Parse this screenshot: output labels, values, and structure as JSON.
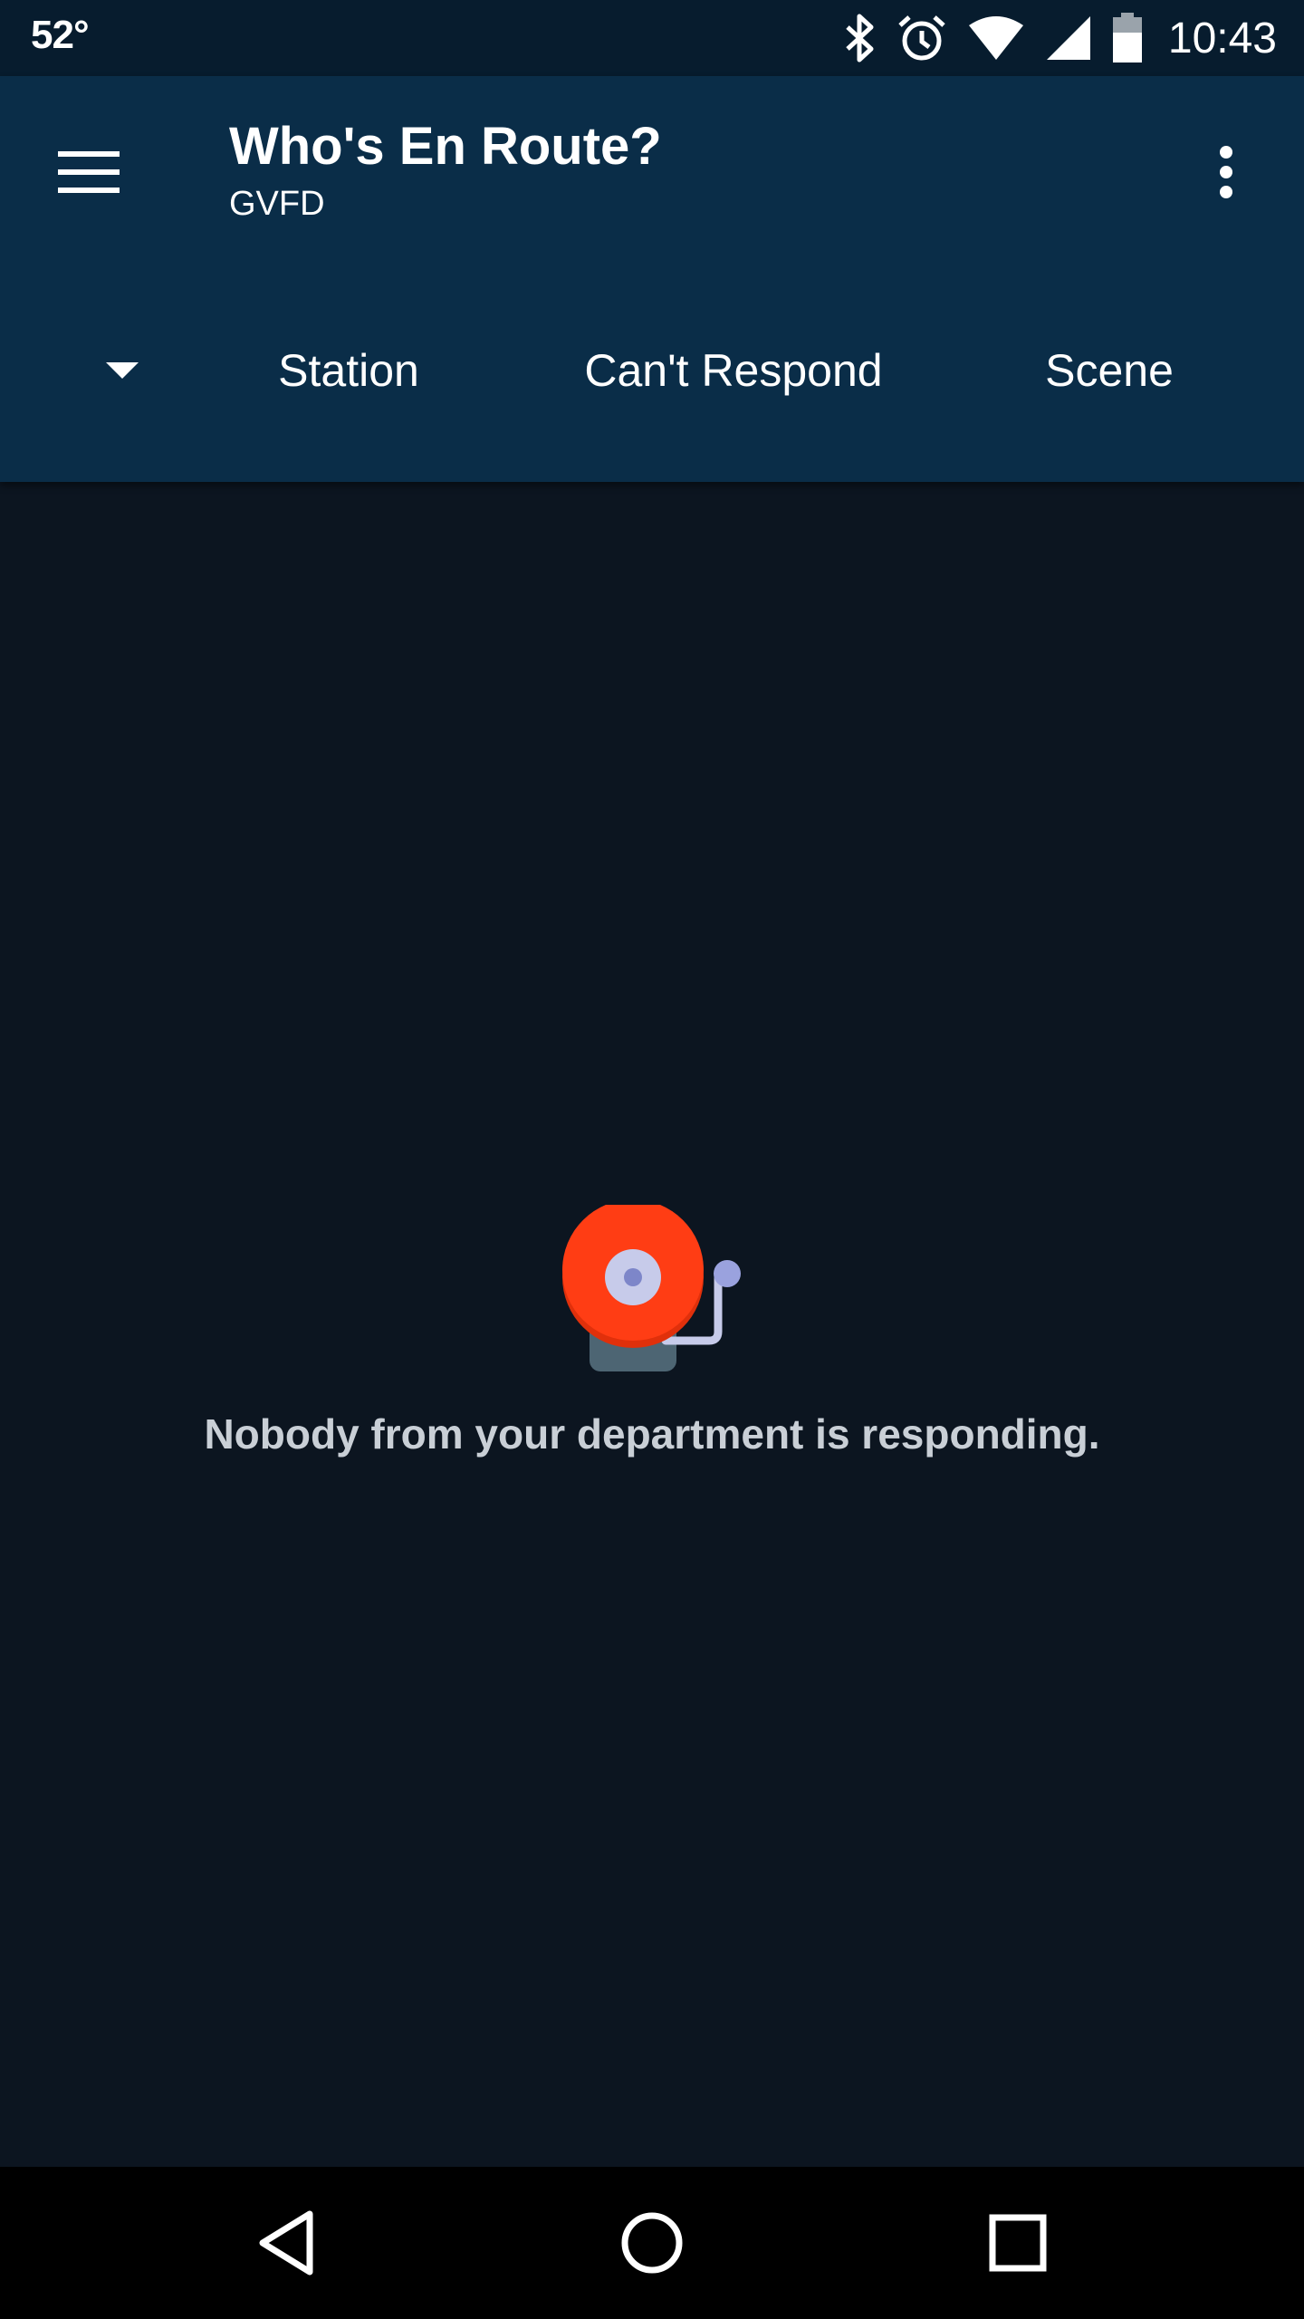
{
  "status_bar": {
    "temperature": "52°",
    "time": "10:43",
    "icons": [
      "bluetooth-icon",
      "alarm-icon",
      "wifi-icon",
      "cell-signal-icon",
      "battery-icon"
    ]
  },
  "app_bar": {
    "title": "Who's En Route?",
    "subtitle": "GVFD",
    "menu_icon": "hamburger-menu-icon",
    "overflow_icon": "more-vert-icon",
    "background_color": "#0a2d48"
  },
  "tabs": {
    "dropdown_icon": "dropdown-arrow-icon",
    "items": [
      {
        "label": "Station"
      },
      {
        "label": "Can't Respond"
      },
      {
        "label": "Scene"
      }
    ]
  },
  "empty_state": {
    "icon": "fire-alarm-bell-icon",
    "message": "Nobody from your department is responding.",
    "bell_color": "#ff3d14"
  },
  "nav_bar": {
    "icons": [
      "back-icon",
      "home-icon",
      "recents-icon"
    ]
  }
}
